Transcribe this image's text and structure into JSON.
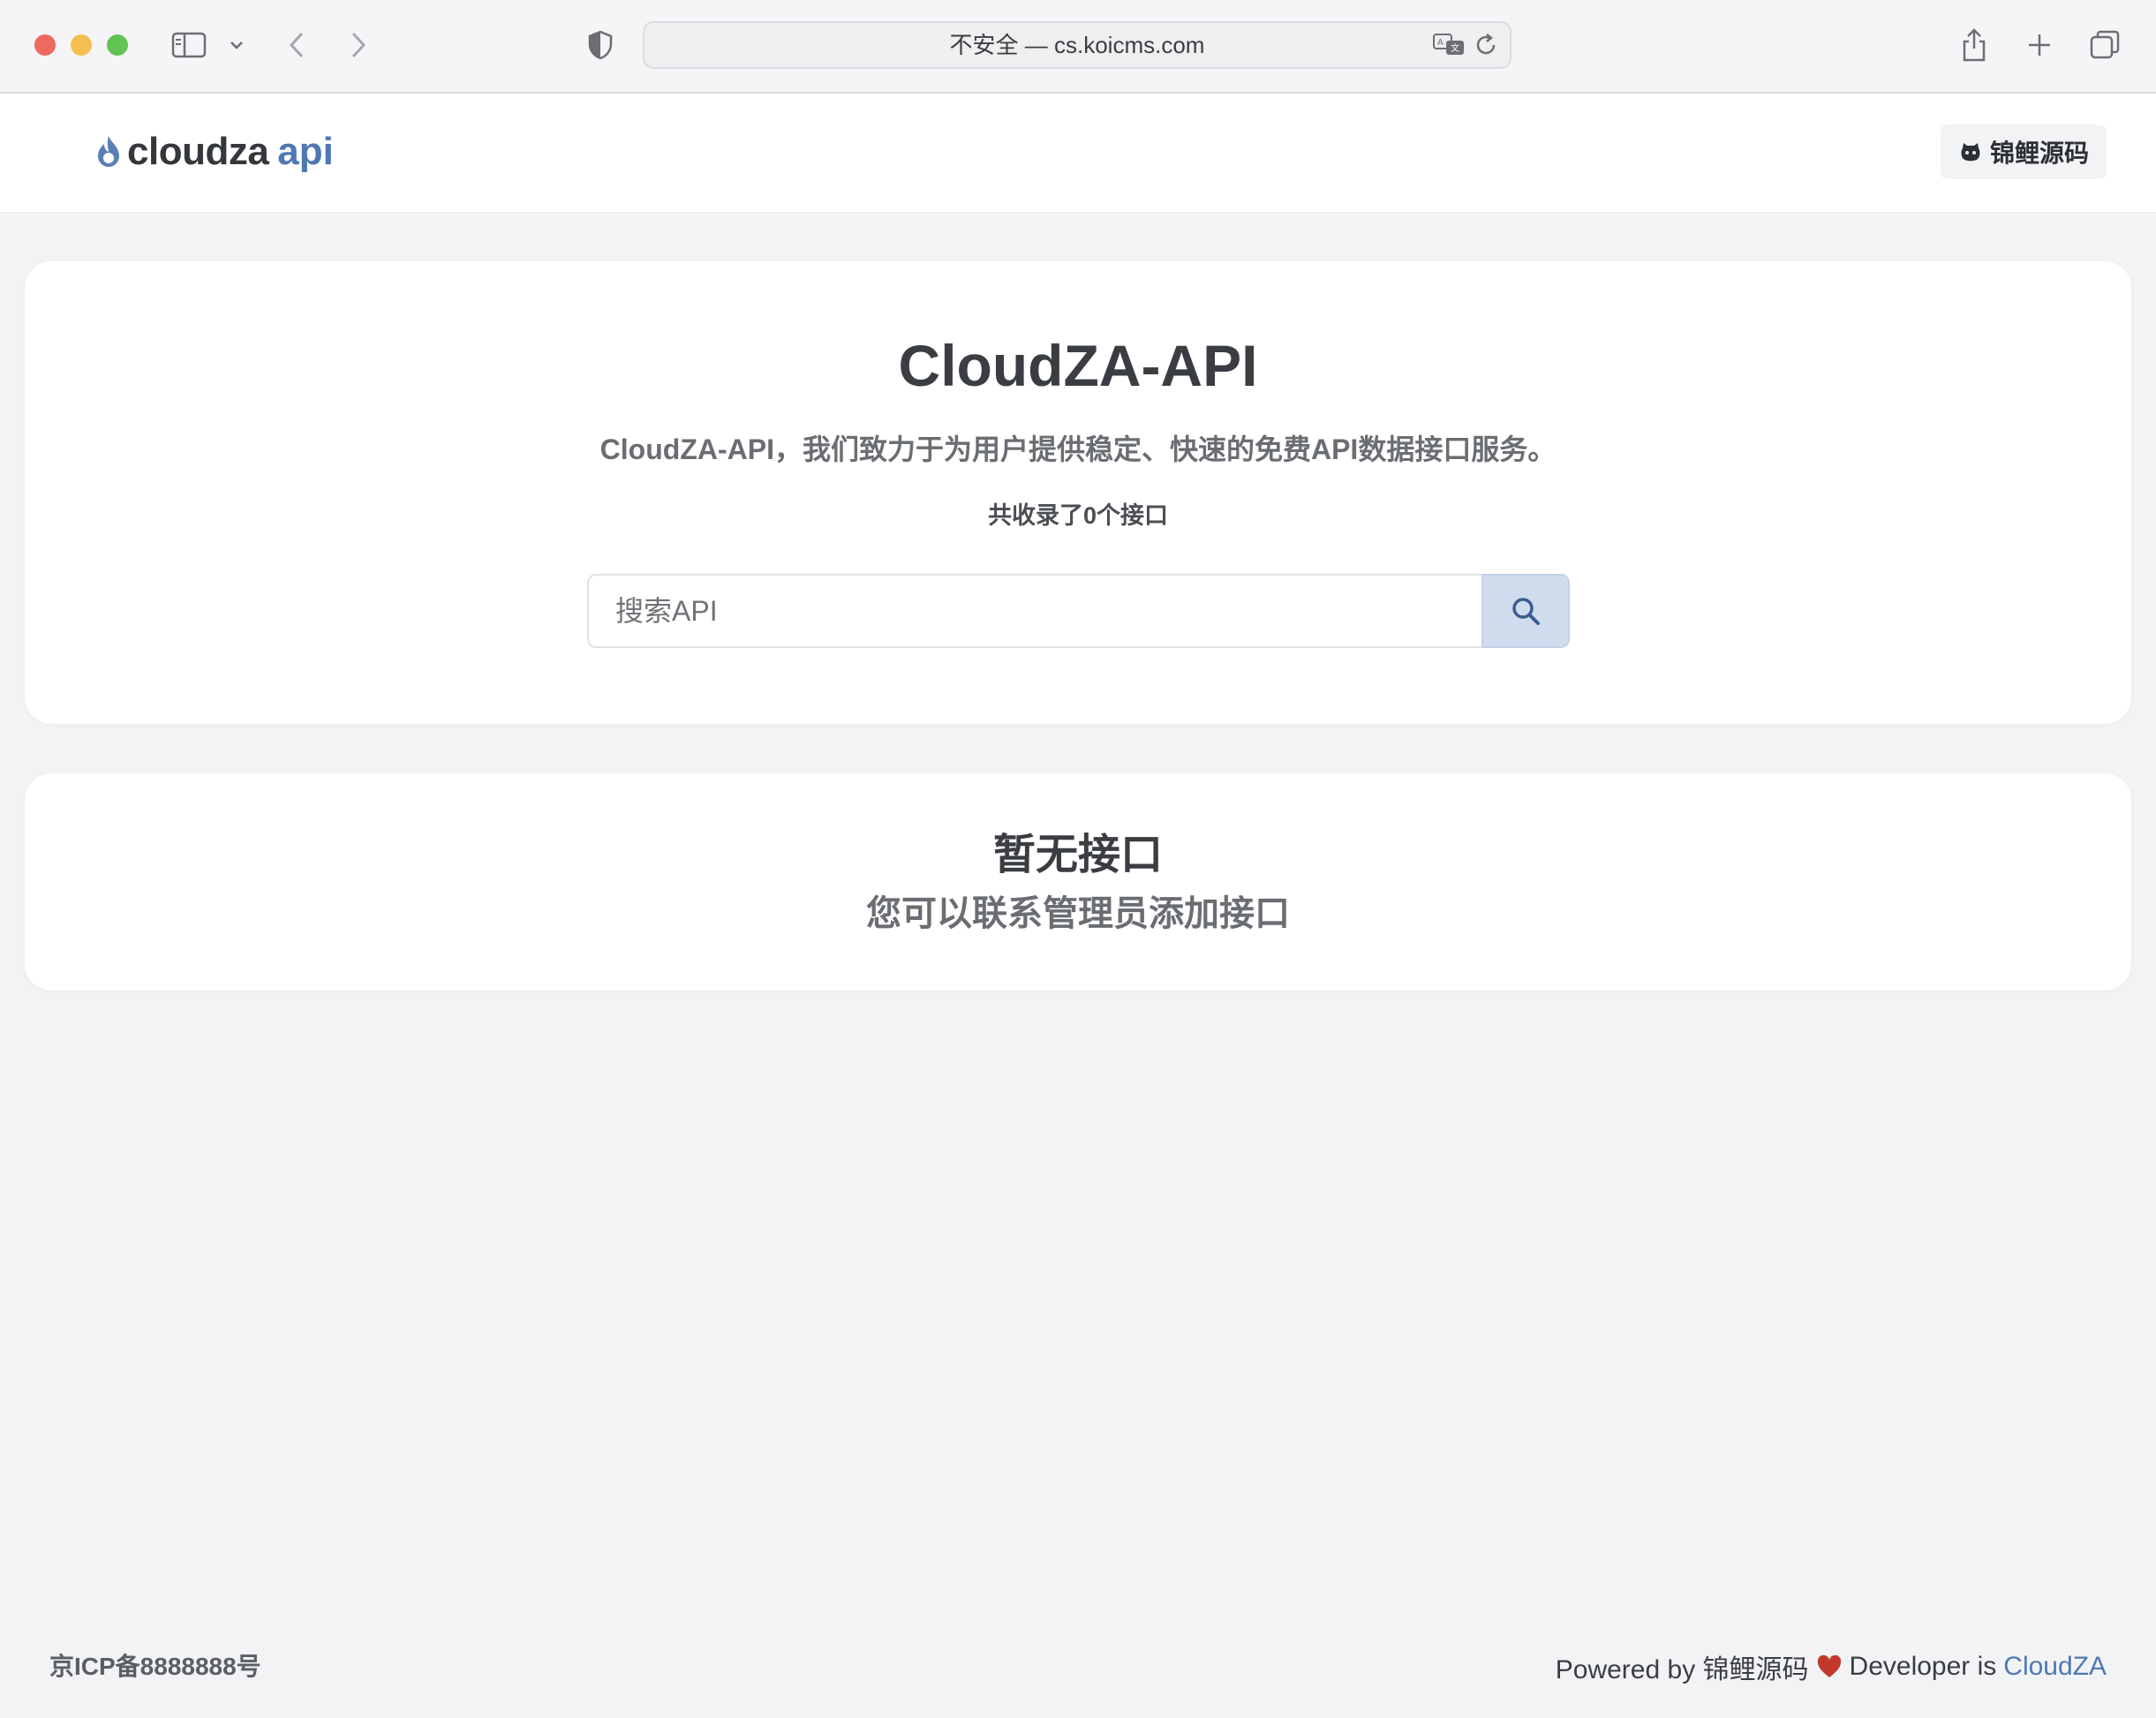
{
  "browser": {
    "url": "不安全 — cs.koicms.com"
  },
  "header": {
    "logo_word": "cloudza",
    "logo_accent": "api",
    "source_button_label": "锦鲤源码"
  },
  "hero": {
    "title": "CloudZA-API",
    "description": "CloudZA-API，我们致力于为用户提供稳定、快速的免费API数据接口服务。",
    "count_text": "共收录了0个接口",
    "search_placeholder": "搜索API"
  },
  "empty_state": {
    "title": "暂无接口",
    "subtitle": "您可以联系管理员添加接口"
  },
  "footer": {
    "icp": "京ICP备8888888号",
    "powered_by": "Powered by 锦鲤源码",
    "developer_prefix": "Developer is",
    "developer_link": "CloudZA"
  },
  "colors": {
    "accent": "#4f78b3",
    "heart": "#c0392b",
    "background": "#f2f3f5"
  }
}
